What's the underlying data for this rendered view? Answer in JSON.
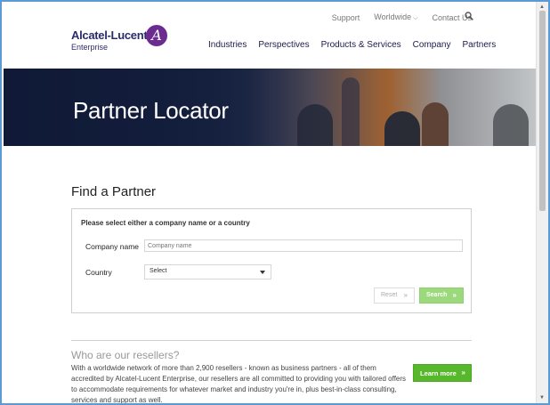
{
  "header": {
    "utility": {
      "support": "Support",
      "worldwide": "Worldwide",
      "contact": "Contact Us"
    },
    "logo": {
      "name": "Alcatel-Lucent",
      "sub": "Enterprise",
      "mark": "A"
    },
    "nav": [
      "Industries",
      "Perspectives",
      "Products & Services",
      "Company",
      "Partners"
    ]
  },
  "hero": {
    "title": "Partner Locator"
  },
  "finder": {
    "title": "Find a Partner",
    "instruction": "Please select either a company name or a country",
    "company_label": "Company name",
    "company_placeholder": "Company name",
    "country_label": "Country",
    "country_value": "Select",
    "reset_label": "Reset",
    "search_label": "Search"
  },
  "resellers": {
    "title": "Who are our resellers?",
    "body": "With a worldwide network of more than 2,900 resellers - known as business partners - all of them accredited by Alcatel-Lucent Enterprise, our resellers are all committed to providing you with tailored offers to accommodate requirements for whatever market and industry you're in, plus best-in-class consulting, services and support as well.",
    "learn_label": "Learn more"
  },
  "colors": {
    "brand": "#2b2b6b",
    "accent": "#6c2b8f",
    "search_button": "#9bd97c",
    "learn_button": "#57b82b"
  },
  "icons": {
    "search": "search-icon",
    "chevron": "chevron-down-icon",
    "double_arrow": "double-chevron-right-icon"
  }
}
